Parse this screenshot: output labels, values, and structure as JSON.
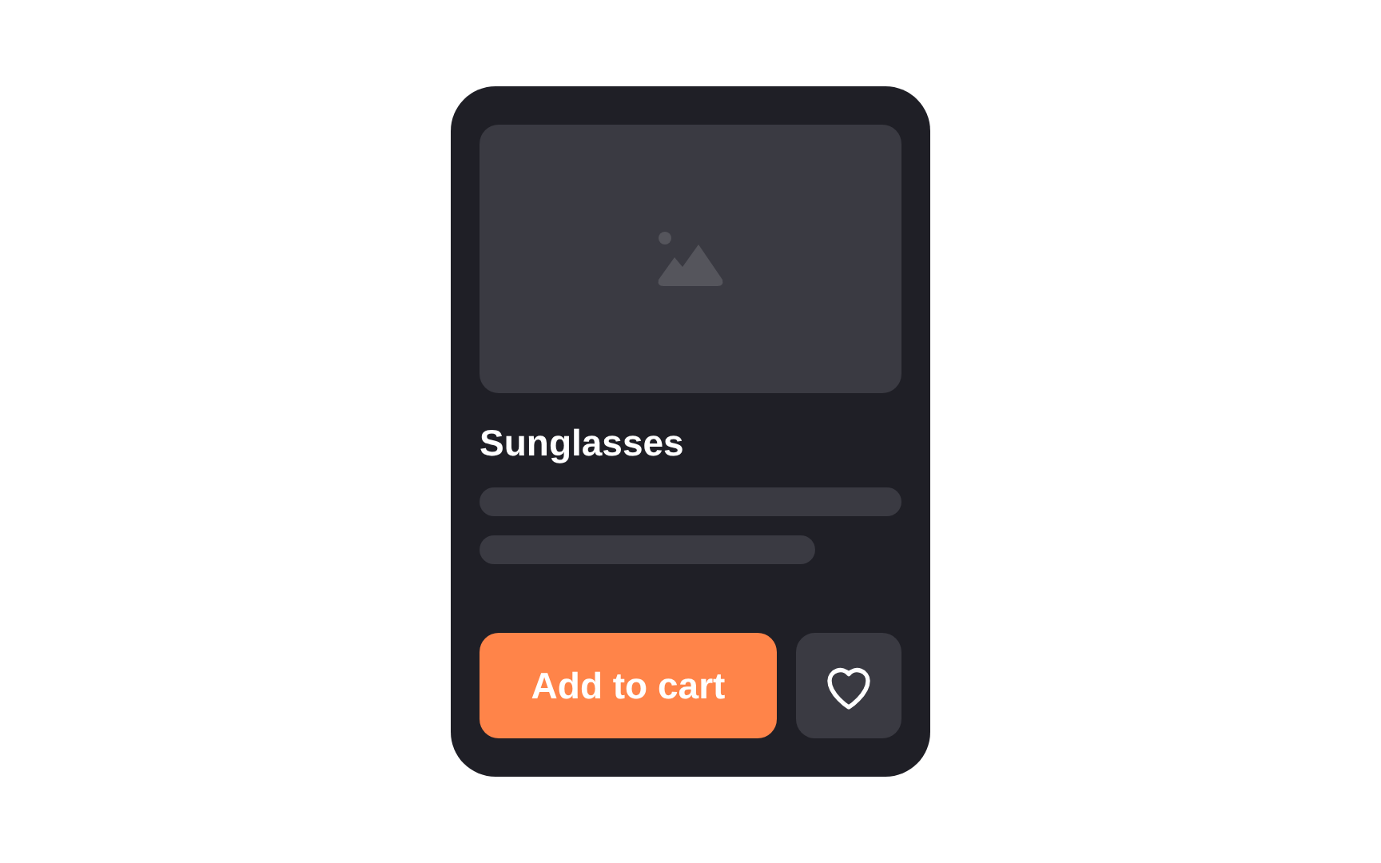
{
  "product": {
    "title": "Sunglasses",
    "image": {
      "kind": "placeholder"
    }
  },
  "actions": {
    "primary": "Add to cart",
    "favorite": false
  }
}
